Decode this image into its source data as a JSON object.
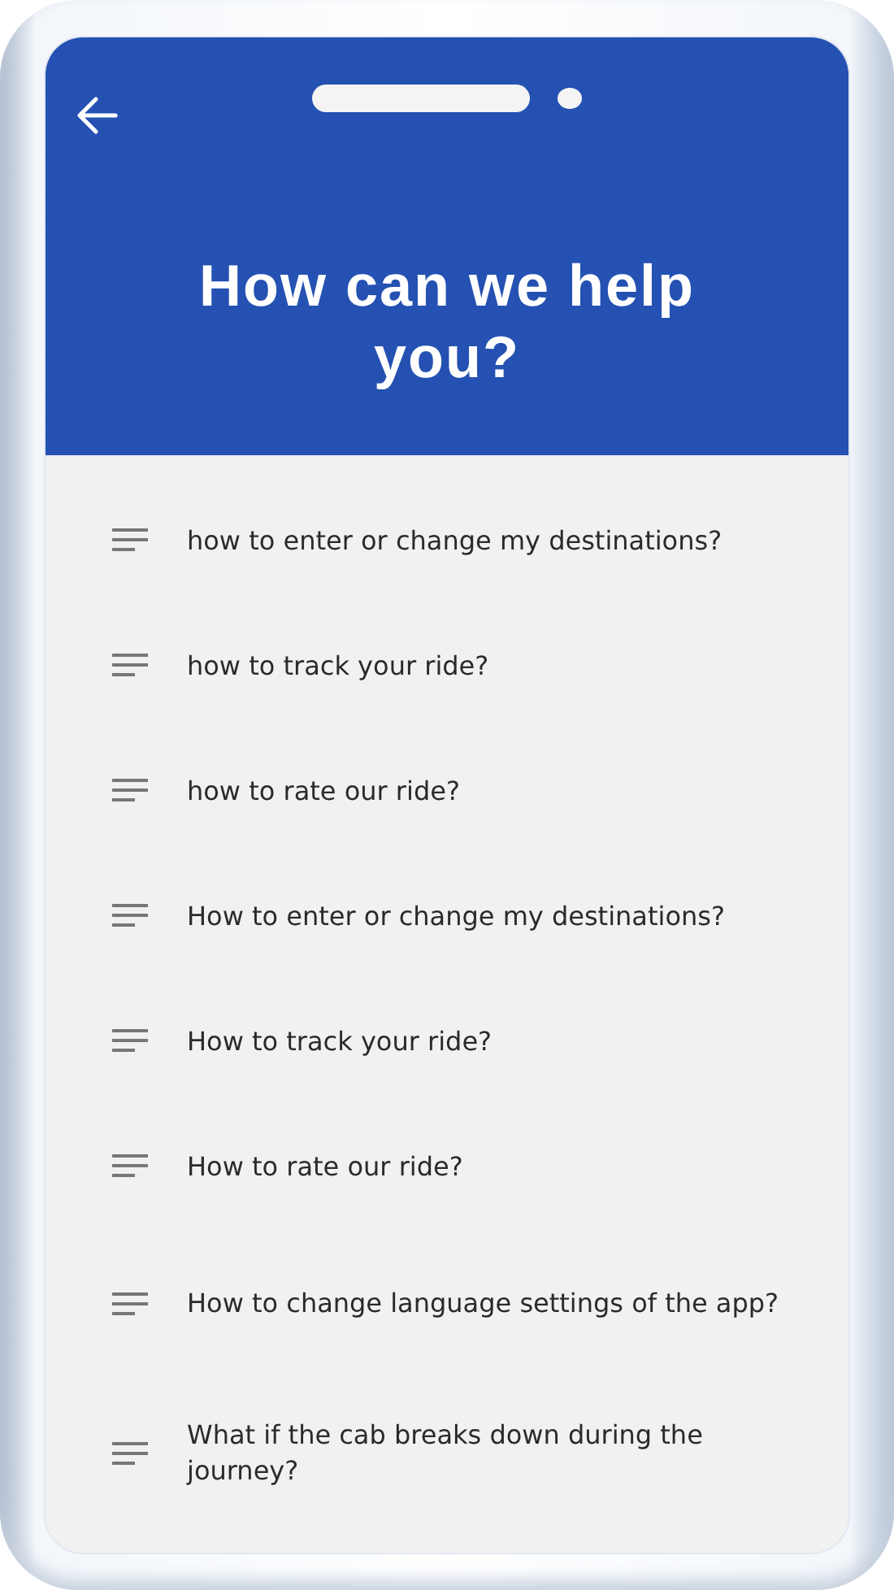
{
  "header": {
    "title": "How can we help you?"
  },
  "questions": [
    {
      "text": "how to enter or change my destinations?"
    },
    {
      "text": "how to track your ride?"
    },
    {
      "text": "how to rate our ride?"
    },
    {
      "text": "How to enter or change my destinations?"
    },
    {
      "text": "How to track your ride?"
    },
    {
      "text": "How to rate our ride?"
    },
    {
      "text": "How to change language settings of the app?"
    },
    {
      "text": "What if the cab breaks down during the journey?"
    }
  ]
}
